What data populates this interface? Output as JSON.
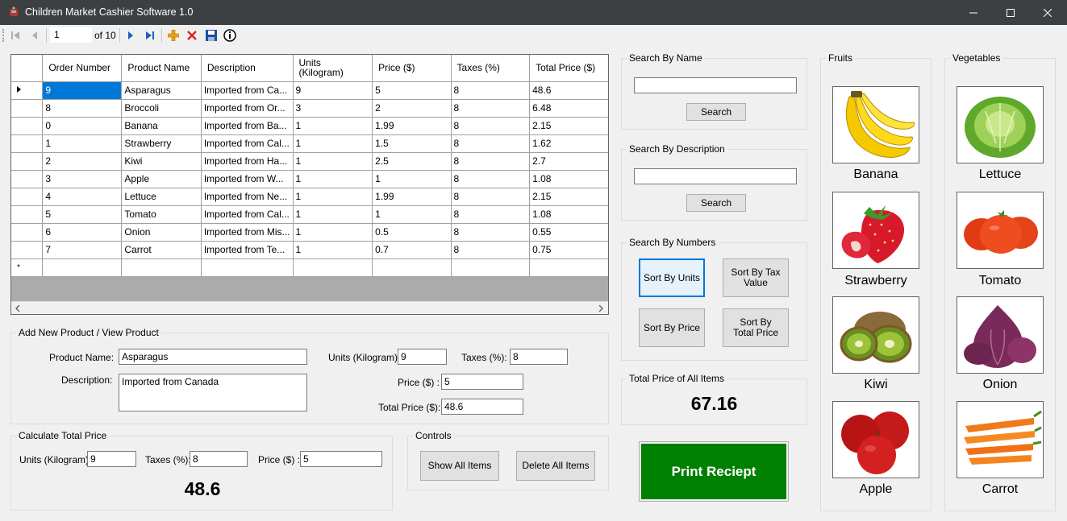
{
  "window": {
    "title": "Children Market Cashier Software 1.0"
  },
  "navigator": {
    "position": "1",
    "count_label": "of 10"
  },
  "grid": {
    "columns": [
      "Order Number",
      "Product Name",
      "Description",
      "Units\n(Kilogram)",
      "Price ($)",
      "Taxes (%)",
      "Total Price ($)"
    ],
    "rows": [
      [
        "9",
        "Asparagus",
        "Imported from Ca...",
        "9",
        "5",
        "8",
        "48.6"
      ],
      [
        "8",
        "Broccoli",
        "Imported from Or...",
        "3",
        "2",
        "8",
        "6.48"
      ],
      [
        "0",
        "Banana",
        "Imported from Ba...",
        "1",
        "1.99",
        "8",
        "2.15"
      ],
      [
        "1",
        "Strawberry",
        "Imported from Cal...",
        "1",
        "1.5",
        "8",
        "1.62"
      ],
      [
        "2",
        "Kiwi",
        "Imported from Ha...",
        "1",
        "2.5",
        "8",
        "2.7"
      ],
      [
        "3",
        "Apple",
        "Imported from W...",
        "1",
        "1",
        "8",
        "1.08"
      ],
      [
        "4",
        "Lettuce",
        "Imported from Ne...",
        "1",
        "1.99",
        "8",
        "2.15"
      ],
      [
        "5",
        "Tomato",
        "Imported from Cal...",
        "1",
        "1",
        "8",
        "1.08"
      ],
      [
        "6",
        "Onion",
        "Imported from Mis...",
        "1",
        "0.5",
        "8",
        "0.55"
      ],
      [
        "7",
        "Carrot",
        "Imported from Te...",
        "1",
        "0.7",
        "8",
        "0.75"
      ]
    ],
    "new_row_marker": "*"
  },
  "add_product": {
    "group_label": "Add New Product / View Product",
    "product_name_label": "Product Name:",
    "product_name_value": "Asparagus",
    "description_label": "Description:",
    "description_value": "Imported from Canada",
    "units_label": "Units (Kilogram):",
    "units_value": "9",
    "taxes_label": "Taxes (%):",
    "taxes_value": "8",
    "price_label": "Price ($) :",
    "price_value": "5",
    "total_label": "Total Price ($):",
    "total_value": "48.6"
  },
  "calculate": {
    "group_label": "Calculate Total Price",
    "units_label": "Units (Kilogram):",
    "units_value": "9",
    "taxes_label": "Taxes (%):",
    "taxes_value": "8",
    "price_label": "Price ($) :",
    "price_value": "5",
    "result": "48.6"
  },
  "controls": {
    "group_label": "Controls",
    "show_all": "Show All Items",
    "delete_all": "Delete All Items"
  },
  "search_name": {
    "group_label": "Search By Name",
    "value": "",
    "button": "Search"
  },
  "search_desc": {
    "group_label": "Search By Description",
    "value": "",
    "button": "Search"
  },
  "search_numbers": {
    "group_label": "Search By Numbers",
    "sort_units": "Sort By Units",
    "sort_tax": "Sort By Tax Value",
    "sort_price": "Sort By Price",
    "sort_total": "Sort By Total Price"
  },
  "total_all": {
    "group_label": "Total Price of All Items",
    "value": "67.16"
  },
  "print": {
    "label": "Print Reciept",
    "color": "#008000"
  },
  "fruits": {
    "group_label": "Fruits",
    "items": [
      "Banana",
      "Strawberry",
      "Kiwi",
      "Apple"
    ]
  },
  "vegetables": {
    "group_label": "Vegetables",
    "items": [
      "Lettuce",
      "Tomato",
      "Onion",
      "Carrot"
    ]
  }
}
